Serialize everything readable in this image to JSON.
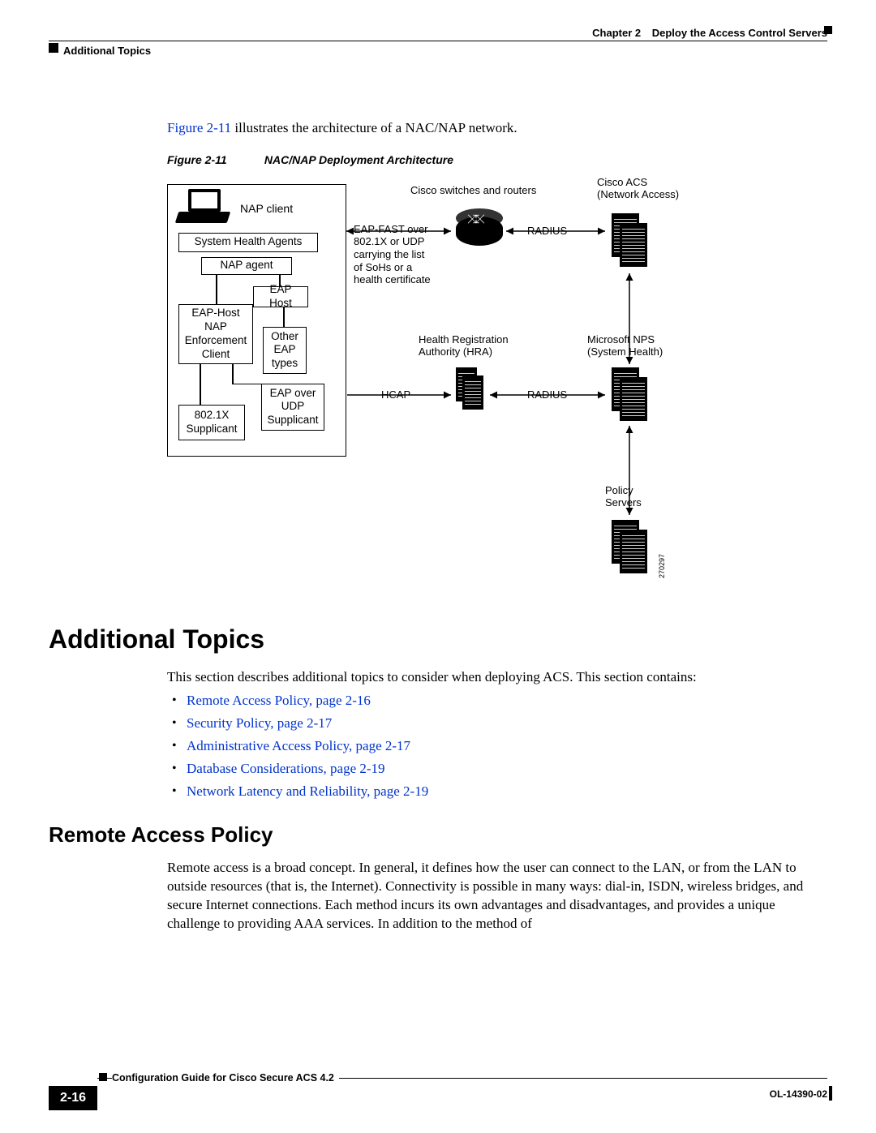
{
  "header": {
    "chapter_prefix": "Chapter 2",
    "chapter_title": "Deploy the Access Control Servers",
    "section": "Additional Topics"
  },
  "intro": {
    "figref": "Figure 2-11",
    "rest": " illustrates the architecture of a NAC/NAP network."
  },
  "figure": {
    "id": "Figure 2-11",
    "title": "NAC/NAP Deployment Architecture",
    "labels": {
      "nap_client": "NAP client",
      "sha": "System Health Agents",
      "nap_agent": "NAP agent",
      "eap_host_nap": "EAP-Host\nNAP\nEnforcement\nClient",
      "eap_host": "EAP Host",
      "other_eap": "Other\nEAP\ntypes",
      "eap_udp": "EAP over\nUDP\nSupplicant",
      "dot1x": "802.1X\nSupplicant",
      "switches": "Cisco switches and routers",
      "acs": "Cisco ACS\n(Network Access)",
      "eapfast": "EAP-FAST over\n802.1X or UDP\ncarrying the list\nof SoHs or a\nhealth certificate",
      "radius1": "RADIUS",
      "hra": "Health Registration\nAuthority (HRA)",
      "nps": "Microsoft NPS\n(System Health)",
      "hcap": "HCAP",
      "radius2": "RADIUS",
      "policy": "Policy\nServers",
      "src_id": "270297"
    }
  },
  "sections": {
    "h1": "Additional Topics",
    "p1": "This section describes additional topics to consider when deploying ACS. This section contains:",
    "bullets": [
      "Remote Access Policy, page 2-16",
      "Security Policy, page 2-17",
      "Administrative Access Policy, page 2-17",
      "Database Considerations, page 2-19",
      "Network Latency and Reliability, page 2-19"
    ],
    "h2": "Remote Access Policy",
    "p2": "Remote access is a broad concept. In general, it defines how the user can connect to the LAN, or from the LAN to outside resources (that is, the Internet). Connectivity is possible in many ways: dial-in, ISDN, wireless bridges, and secure Internet connections. Each method incurs its own advantages and disadvantages, and provides a unique challenge to providing AAA services. In addition to the method of"
  },
  "footer": {
    "guide": "Configuration Guide for Cisco Secure ACS 4.2",
    "page": "2-16",
    "docid": "OL-14390-02"
  }
}
